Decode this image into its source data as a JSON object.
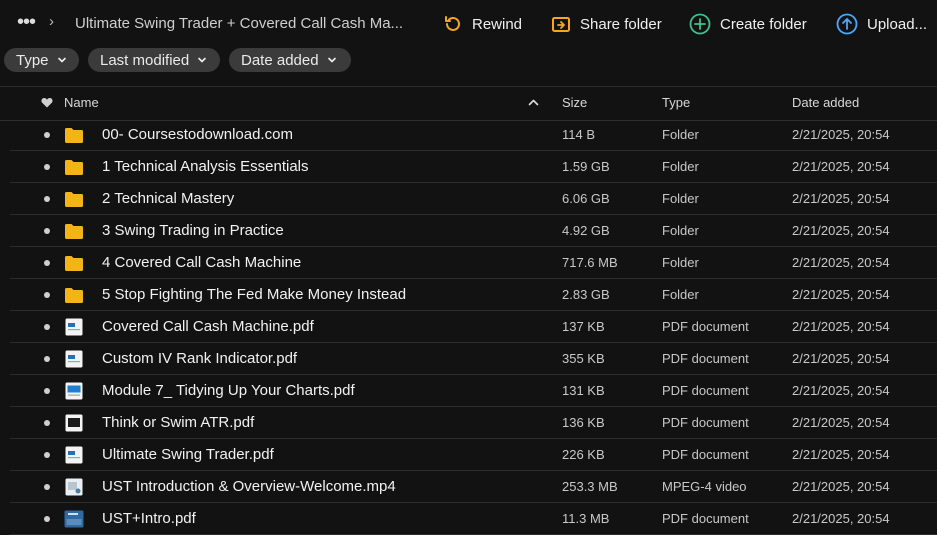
{
  "breadcrumb": {
    "more_label": "•••",
    "separator": "›",
    "current": "Ultimate Swing Trader + Covered Call Cash Ma..."
  },
  "actions": [
    {
      "label": "Rewind",
      "icon": "rewind-icon",
      "color": "#f5a623"
    },
    {
      "label": "Share folder",
      "icon": "share-folder-icon",
      "color": "#f5a623"
    },
    {
      "label": "Create folder",
      "icon": "create-folder-icon",
      "color": "#3ec28f"
    },
    {
      "label": "Upload...",
      "icon": "upload-icon",
      "color": "#4aa8ff"
    }
  ],
  "filters": [
    {
      "label": "Type"
    },
    {
      "label": "Last modified"
    },
    {
      "label": "Date added"
    }
  ],
  "table": {
    "columns": {
      "name": "Name",
      "size": "Size",
      "type": "Type",
      "date_added": "Date added"
    },
    "sort": {
      "column": "name",
      "direction": "ascending"
    },
    "rows": [
      {
        "kind": "folder",
        "name": "00- Coursestodownload.com",
        "size": "114 B",
        "type": "Folder",
        "date": "2/21/2025, 20:54"
      },
      {
        "kind": "folder",
        "name": "1 Technical Analysis Essentials",
        "size": "1.59 GB",
        "type": "Folder",
        "date": "2/21/2025, 20:54"
      },
      {
        "kind": "folder",
        "name": "2 Technical Mastery",
        "size": "6.06 GB",
        "type": "Folder",
        "date": "2/21/2025, 20:54"
      },
      {
        "kind": "folder",
        "name": "3 Swing Trading in Practice",
        "size": "4.92 GB",
        "type": "Folder",
        "date": "2/21/2025, 20:54"
      },
      {
        "kind": "folder",
        "name": "4 Covered Call Cash Machine",
        "size": "717.6 MB",
        "type": "Folder",
        "date": "2/21/2025, 20:54"
      },
      {
        "kind": "folder",
        "name": "5 Stop Fighting The Fed Make Money Instead",
        "size": "2.83 GB",
        "type": "Folder",
        "date": "2/21/2025, 20:54"
      },
      {
        "kind": "pdf",
        "name": "Covered Call Cash Machine.pdf",
        "size": "137 KB",
        "type": "PDF document",
        "date": "2/21/2025, 20:54"
      },
      {
        "kind": "pdf",
        "name": "Custom IV Rank Indicator.pdf",
        "size": "355 KB",
        "type": "PDF document",
        "date": "2/21/2025, 20:54"
      },
      {
        "kind": "pdf-blue",
        "name": "Module 7_ Tidying Up Your Charts.pdf",
        "size": "131 KB",
        "type": "PDF document",
        "date": "2/21/2025, 20:54"
      },
      {
        "kind": "pdf-dark",
        "name": "Think or Swim ATR.pdf",
        "size": "136 KB",
        "type": "PDF document",
        "date": "2/21/2025, 20:54"
      },
      {
        "kind": "pdf",
        "name": "Ultimate Swing Trader.pdf",
        "size": "226 KB",
        "type": "PDF document",
        "date": "2/21/2025, 20:54"
      },
      {
        "kind": "video",
        "name": "UST Introduction & Overview-Welcome.mp4",
        "size": "253.3 MB",
        "type": "MPEG-4 video",
        "date": "2/21/2025, 20:54"
      },
      {
        "kind": "pdf-thumb",
        "name": "UST+Intro.pdf",
        "size": "11.3 MB",
        "type": "PDF document",
        "date": "2/21/2025, 20:54"
      }
    ]
  },
  "colors": {
    "background": "#121212",
    "folder": "#f5b31a",
    "chip": "#3b3b3b"
  }
}
